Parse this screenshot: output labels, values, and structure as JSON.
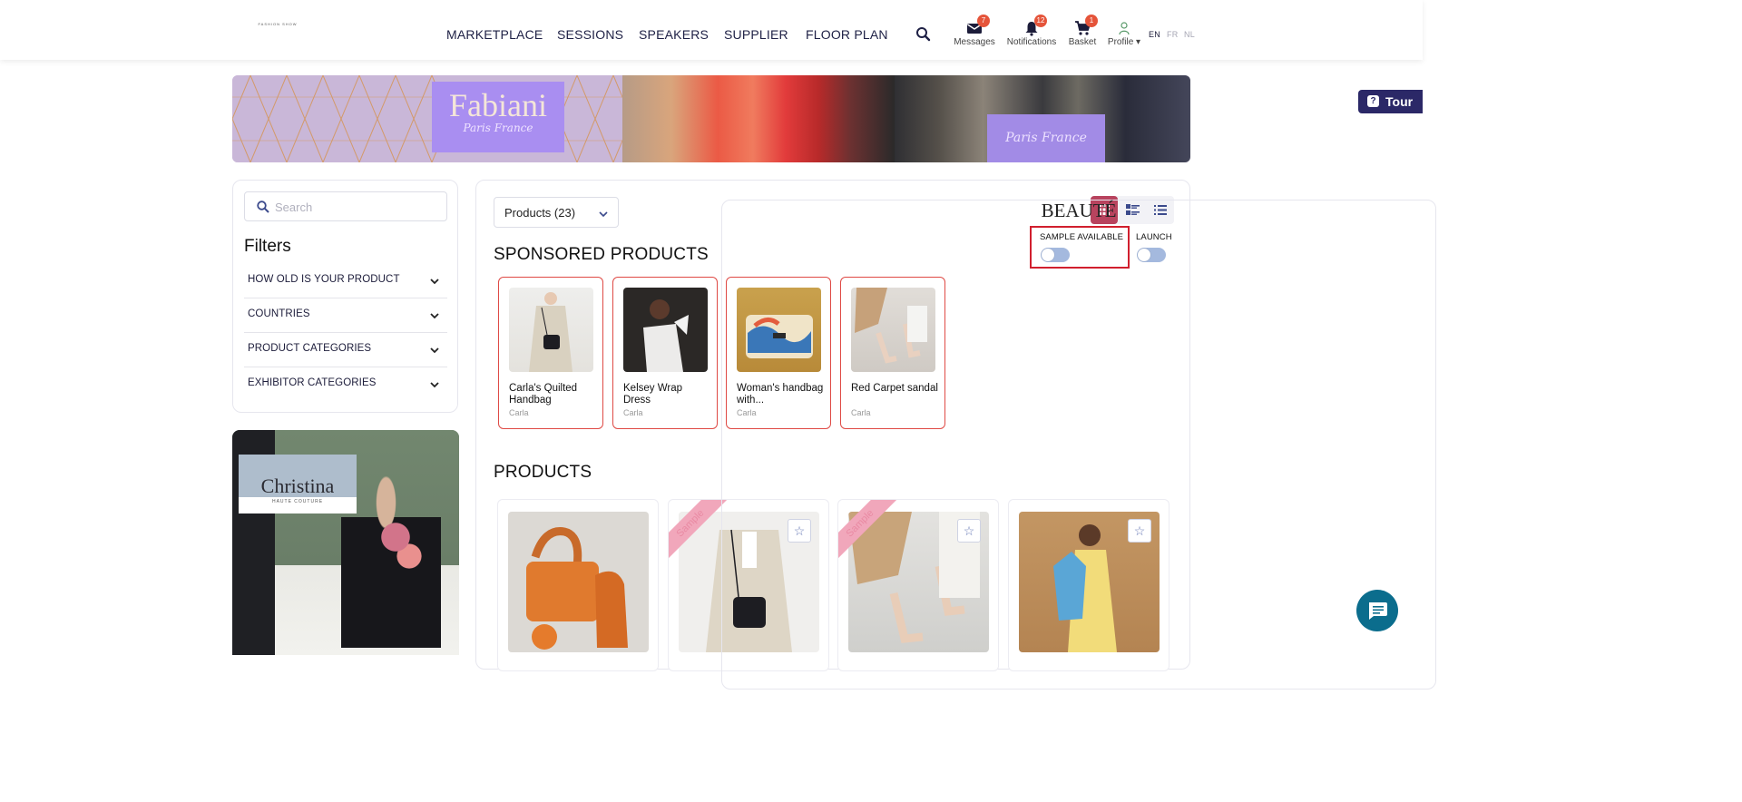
{
  "header": {
    "logo_main": "BEAUTÉ",
    "logo_sub": "FASHION SHOW",
    "nav": [
      "MARKETPLACE",
      "SESSIONS",
      "SPEAKERS",
      "SUPPLIER",
      "FLOOR PLAN"
    ],
    "icons": {
      "messages": {
        "label": "Messages",
        "badge": "7"
      },
      "notifications": {
        "label": "Notifications",
        "badge": "12"
      },
      "basket": {
        "label": "Basket",
        "badge": "1"
      },
      "profile": {
        "label": "Profile"
      }
    },
    "languages": [
      "EN",
      "FR",
      "NL"
    ],
    "active_language": "EN"
  },
  "banner": {
    "brand": "Fabiani",
    "tagline": "Paris France",
    "tagline2": "Paris France"
  },
  "tour": {
    "label": "Tour"
  },
  "sidebar": {
    "search_placeholder": "Search",
    "filters_title": "Filters",
    "filters": [
      "HOW OLD IS YOUR PRODUCT",
      "COUNTRIES",
      "PRODUCT CATEGORIES",
      "EXHIBITOR CATEGORIES"
    ],
    "ad": {
      "name": "Christina",
      "sub": "HAUTE COUTURE"
    }
  },
  "main": {
    "select_value": "Products (23)",
    "sponsored_title": "SPONSORED PRODUCTS",
    "products_title": "PRODUCTS",
    "toggles": [
      {
        "label": "SAMPLE AVAILABLE",
        "on": false
      },
      {
        "label": "LAUNCH",
        "on": false
      }
    ],
    "sponsored": [
      {
        "name": "Carla's Quilted Handbag",
        "brand": "Carla"
      },
      {
        "name": "Kelsey Wrap Dress",
        "brand": "Carla"
      },
      {
        "name": "Woman's handbag with...",
        "brand": "Carla"
      },
      {
        "name": "Red Carpet sandal",
        "brand": "Carla"
      }
    ],
    "sample_ribbon": "Sample"
  },
  "colors": {
    "accent": "#b8435e",
    "nav_text": "#1e2045",
    "tour_bg": "#2b2867",
    "badge": "#e5543a",
    "chat": "#0b6d8d",
    "highlight": "#d11f2e"
  }
}
